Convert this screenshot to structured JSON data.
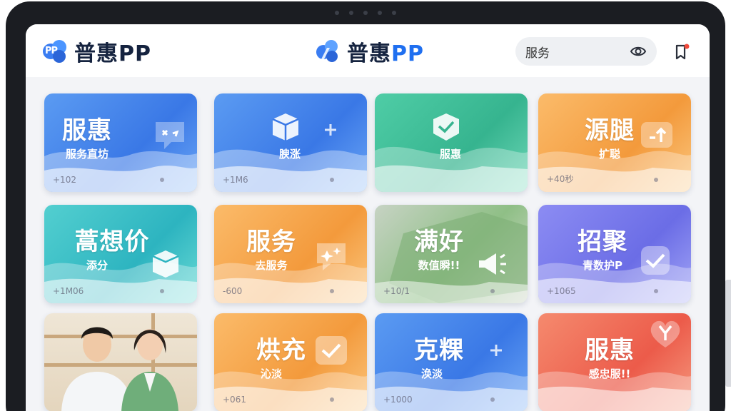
{
  "app": {
    "brand_left": "普惠PP",
    "brand_center_cn": "普惠",
    "brand_center_latin": "PP",
    "logo_badge": "PP"
  },
  "search": {
    "value": "服务",
    "placeholder": "服务"
  },
  "icons": {
    "visibility": "eye-icon",
    "notification": "bookmark-alert-icon"
  },
  "tiles": [
    {
      "title": "服惠",
      "subtitle": "服务直坊",
      "footer": "+102",
      "color": "#3a78e6",
      "icon": "chat-bubble-icon"
    },
    {
      "title": "",
      "subtitle": "腴涨",
      "footer": "+1M6",
      "color": "#3a78e6",
      "icon": "cube-icon"
    },
    {
      "title": "",
      "subtitle": "服惠",
      "footer": "",
      "color": "#36b48f",
      "icon": "shield-cube-icon"
    },
    {
      "title": "源腿",
      "subtitle": "扩聪",
      "footer": "+40秒",
      "color": "#f39a3c",
      "icon": "transfer-icon"
    },
    {
      "title": "蒿想价",
      "subtitle": "添分",
      "footer": "+1M06",
      "color": "#2db4c0",
      "icon": "cube-arrow-icon"
    },
    {
      "title": "服务",
      "subtitle": "去服务",
      "footer": "-600",
      "color": "#f39a3c",
      "icon": "sparkle-bubble-icon"
    },
    {
      "title": "满好",
      "subtitle": "数值瞬!!",
      "footer": "+10/1",
      "color": "#8fbf86",
      "icon": "megaphone-icon"
    },
    {
      "title": "招聚",
      "subtitle": "青数护P",
      "footer": "+1065",
      "color": "#6b6de6",
      "icon": "check-box-icon"
    },
    {
      "title": "",
      "subtitle": "",
      "footer": "",
      "color": "#e4d5bd",
      "icon": ""
    },
    {
      "title": "烘充",
      "subtitle": "沁淡",
      "footer": "+061",
      "color": "#f39a3c",
      "icon": "check-bubble-icon"
    },
    {
      "title": "克粿",
      "subtitle": "涣淡",
      "footer": "+1000",
      "color": "#3a78e6",
      "icon": "plus-icon"
    },
    {
      "title": "服惠",
      "subtitle": "感忠服!!",
      "footer": "",
      "color": "#ec5b4a",
      "icon": "heart-y-icon"
    }
  ]
}
